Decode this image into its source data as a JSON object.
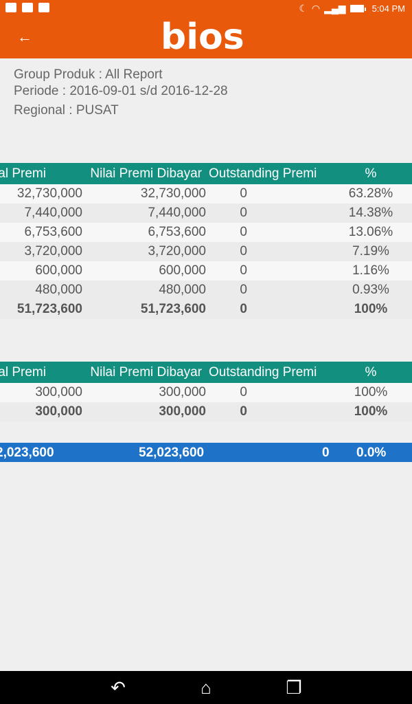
{
  "status": {
    "time": "5:04 PM"
  },
  "app": {
    "logo": "bios"
  },
  "info": {
    "group": "Group Produk : All Report",
    "periode": "Periode : 2016-09-01 s/d 2016-12-28",
    "regional": "Regional : PUSAT"
  },
  "table1": {
    "headers": [
      "tal Premi",
      "Nilai Premi Dibayar",
      "Outstanding Premi",
      "%"
    ],
    "rows": [
      [
        "32,730,000",
        "32,730,000",
        "0",
        "63.28%"
      ],
      [
        "7,440,000",
        "7,440,000",
        "0",
        "14.38%"
      ],
      [
        "6,753,600",
        "6,753,600",
        "0",
        "13.06%"
      ],
      [
        "3,720,000",
        "3,720,000",
        "0",
        "7.19%"
      ],
      [
        "600,000",
        "600,000",
        "0",
        "1.16%"
      ],
      [
        "480,000",
        "480,000",
        "0",
        "0.93%"
      ]
    ],
    "total": [
      "51,723,600",
      "51,723,600",
      "0",
      "100%"
    ]
  },
  "table2": {
    "headers": [
      "tal Premi",
      "Nilai Premi Dibayar",
      "Outstanding Premi",
      "%"
    ],
    "rows": [
      [
        "300,000",
        "300,000",
        "0",
        "100%"
      ]
    ],
    "total": [
      "300,000",
      "300,000",
      "0",
      "100%"
    ]
  },
  "grand_total": [
    "2,023,600",
    "52,023,600",
    "0",
    "0.0%"
  ],
  "icons": {
    "back": "arrow-left-icon",
    "nav_back": "back-icon",
    "nav_home": "home-icon",
    "nav_recents": "recents-icon"
  }
}
